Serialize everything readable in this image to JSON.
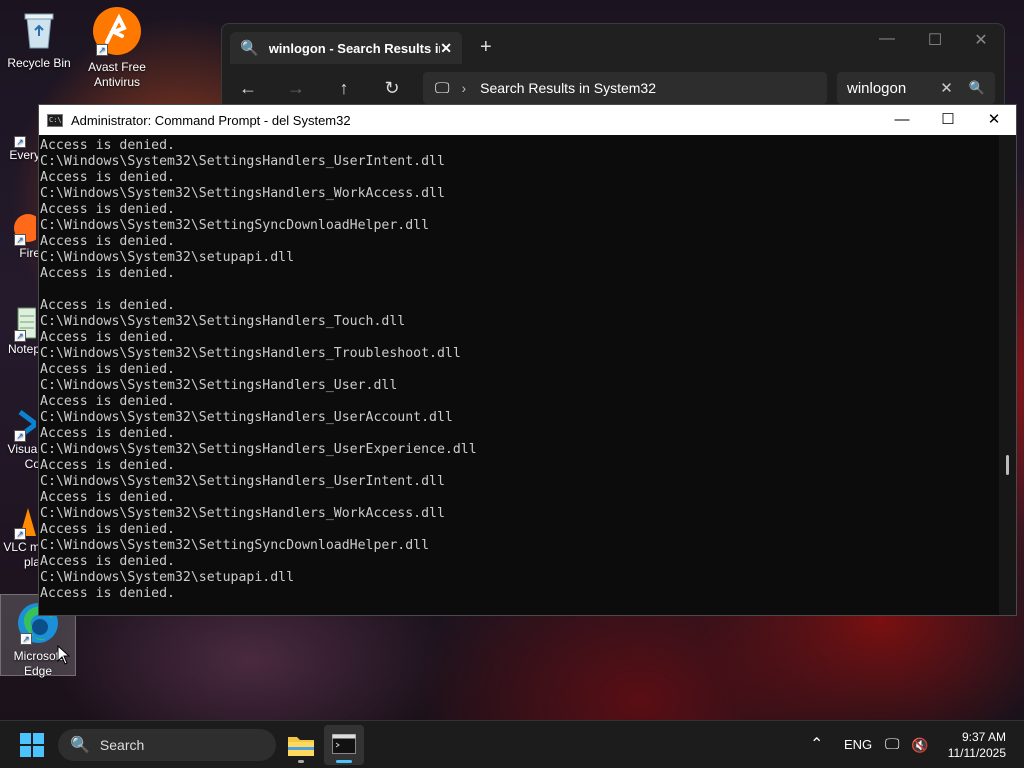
{
  "desktop": {
    "icons": [
      {
        "label": "Recycle Bin"
      },
      {
        "label": "Avast Free Antivirus"
      },
      {
        "label": "Every"
      },
      {
        "label": "Fire"
      },
      {
        "label": "Notep"
      },
      {
        "label": "Visual\nCo"
      },
      {
        "label": "VLC m\npla"
      },
      {
        "label": "Microsoft\nEdge"
      }
    ]
  },
  "explorer": {
    "tab_title": "winlogon - Search Results in S",
    "address_text": "Search Results in System32",
    "search_value": "winlogon"
  },
  "cmd": {
    "title": "Administrator: Command Prompt - del  System32",
    "lines": [
      "Access is denied.",
      "C:\\Windows\\System32\\SettingsHandlers_UserIntent.dll",
      "Access is denied.",
      "C:\\Windows\\System32\\SettingsHandlers_WorkAccess.dll",
      "Access is denied.",
      "C:\\Windows\\System32\\SettingSyncDownloadHelper.dll",
      "Access is denied.",
      "C:\\Windows\\System32\\setupapi.dll",
      "Access is denied.",
      "",
      "Access is denied.",
      "C:\\Windows\\System32\\SettingsHandlers_Touch.dll",
      "Access is denied.",
      "C:\\Windows\\System32\\SettingsHandlers_Troubleshoot.dll",
      "Access is denied.",
      "C:\\Windows\\System32\\SettingsHandlers_User.dll",
      "Access is denied.",
      "C:\\Windows\\System32\\SettingsHandlers_UserAccount.dll",
      "Access is denied.",
      "C:\\Windows\\System32\\SettingsHandlers_UserExperience.dll",
      "Access is denied.",
      "C:\\Windows\\System32\\SettingsHandlers_UserIntent.dll",
      "Access is denied.",
      "C:\\Windows\\System32\\SettingsHandlers_WorkAccess.dll",
      "Access is denied.",
      "C:\\Windows\\System32\\SettingSyncDownloadHelper.dll",
      "Access is denied.",
      "C:\\Windows\\System32\\setupapi.dll",
      "Access is denied."
    ]
  },
  "taskbar": {
    "search_placeholder": "Search",
    "language": "ENG",
    "time": "9:37 AM",
    "date": "11/11/2025"
  },
  "icons": {
    "start": "windows-start-icon",
    "explorer": "folder-icon",
    "terminal": "terminal-icon"
  },
  "colors": {
    "accent": "#4cc2ff",
    "cmd_text": "#cccccc",
    "cmd_bg": "#0c0c0c"
  }
}
